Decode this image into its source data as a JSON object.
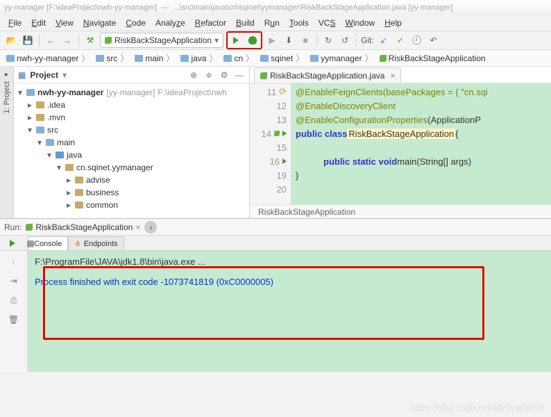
{
  "title": {
    "left": "yy-manager [F:\\ideaProject\\nwh-yy-manager]",
    "right": "...\\src\\main\\java\\cn\\sqinet\\yymanager\\RiskBackStageApplication.java [yy-manager]"
  },
  "menu": [
    "File",
    "Edit",
    "View",
    "Navigate",
    "Code",
    "Analyze",
    "Refactor",
    "Build",
    "Run",
    "Tools",
    "VCS",
    "Window",
    "Help"
  ],
  "toolbar": {
    "run_config": "RiskBackStageApplication",
    "git_label": "Git:"
  },
  "breadcrumbs": [
    "nwh-yy-manager",
    "src",
    "main",
    "java",
    "cn",
    "sqinet",
    "yymanager",
    "RiskBackStageApplication"
  ],
  "project": {
    "label": "Project",
    "root": "nwh-yy-manager",
    "root_tag": "[yy-manager]",
    "root_path": "F:\\ideaProject\\nwh",
    "items": [
      ".idea",
      ".mvn"
    ],
    "src": "src",
    "main": "main",
    "java": "java",
    "pkg": "cn.sqinet.yymanager",
    "subs": [
      "advise",
      "business",
      "common"
    ]
  },
  "editor": {
    "tab": "RiskBackStageApplication.java",
    "crumb": "RiskBackStageApplication",
    "lines": {
      "l11": "@EnableFeignClients(basePackages = { \"cn.sqi",
      "l12": "@EnableDiscoveryClient",
      "l13a": "@EnableConfigurationProperties",
      "l13b": "(ApplicationP",
      "l14a": "public class ",
      "l14b": "RiskBackStageApplication",
      "l14c": " {",
      "l16a": "public static void ",
      "l16b": "main",
      "l16c": "(String[] args)",
      "l19": "}"
    },
    "nums": [
      "11",
      "12",
      "13",
      "14",
      "15",
      "16",
      "19",
      "20"
    ]
  },
  "run": {
    "tool_label": "Run:",
    "title": "RiskBackStageApplication",
    "tabs": [
      "Console",
      "Endpoints"
    ],
    "console_line1": "F:\\ProgramFile\\JAVA\\jdk1.8\\bin\\java.exe ...",
    "console_line2": "Process finished with exit code -1073741819 (0xC0000005)"
  },
  "sidebar_tab": "1: Project",
  "watermark": "https://blog.csdn.net/MyOracleFei"
}
